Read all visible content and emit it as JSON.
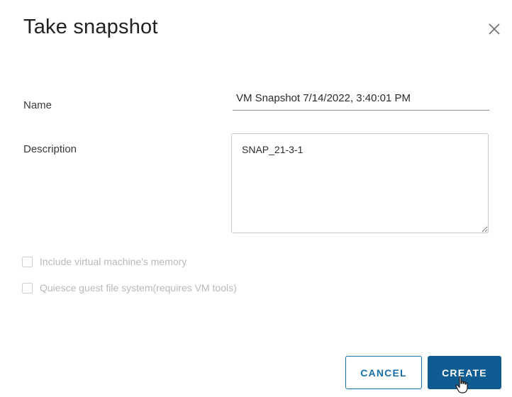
{
  "dialog": {
    "title": "Take snapshot",
    "close_icon": "close-icon"
  },
  "form": {
    "name_label": "Name",
    "name_value": "VM Snapshot 7/14/2022, 3:40:01 PM",
    "description_label": "Description",
    "description_value": "SNAP_21-3-1",
    "include_memory_label": "Include virtual machine's memory",
    "include_memory_checked": false,
    "include_memory_disabled": true,
    "quiesce_label": "Quiesce guest file system(requires VM tools)",
    "quiesce_checked": false,
    "quiesce_disabled": true
  },
  "buttons": {
    "cancel_label": "CANCEL",
    "create_label": "CREATE"
  },
  "colors": {
    "primary": "#0f5c93",
    "secondary_border": "#1b6fa8",
    "disabled_text": "#b9b9b9"
  },
  "cursor": "hand-pointer-icon"
}
